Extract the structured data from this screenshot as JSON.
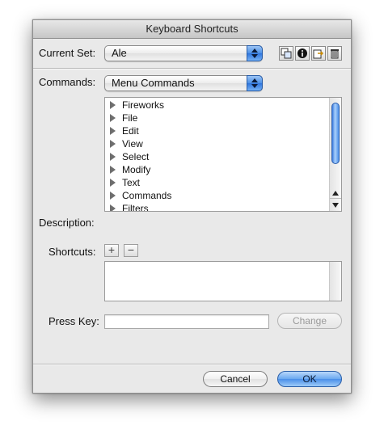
{
  "window": {
    "title": "Keyboard Shortcuts"
  },
  "current_set": {
    "label": "Current Set:",
    "value": "Ale",
    "icons": [
      "duplicate-set-icon",
      "info-icon",
      "export-set-icon",
      "trash-icon"
    ]
  },
  "commands": {
    "label": "Commands:",
    "value": "Menu Commands",
    "items": [
      "Fireworks",
      "File",
      "Edit",
      "View",
      "Select",
      "Modify",
      "Text",
      "Commands",
      "Filters"
    ]
  },
  "description": {
    "label": "Description:"
  },
  "shortcuts": {
    "label": "Shortcuts:",
    "add_glyph": "+",
    "remove_glyph": "−"
  },
  "press_key": {
    "label": "Press Key:",
    "value": "",
    "change_label": "Change"
  },
  "footer": {
    "cancel_label": "Cancel",
    "ok_label": "OK"
  },
  "colors": {
    "window_bg": "#e9e9e9",
    "accent_blue": "#4a8fe9"
  }
}
